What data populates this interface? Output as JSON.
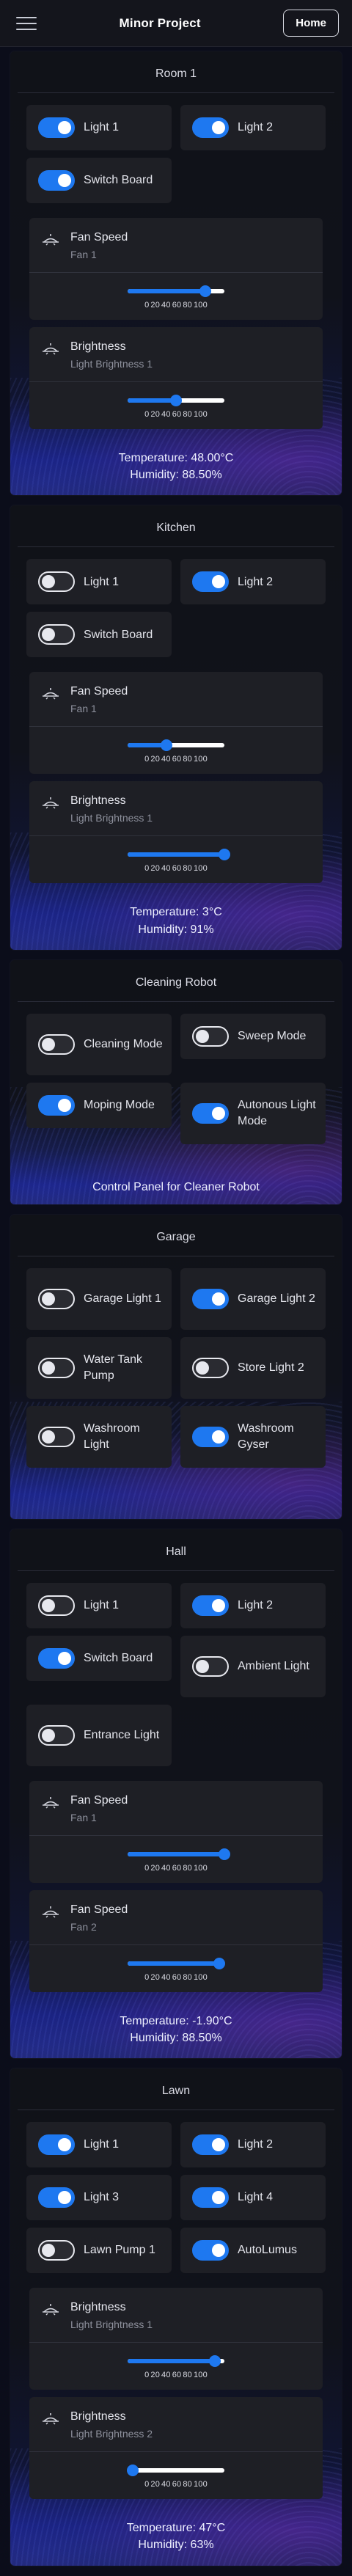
{
  "navbar": {
    "title": "Minor Project",
    "home_label": "Home"
  },
  "tick_labels": [
    "0",
    "20",
    "40",
    "60",
    "80",
    "100"
  ],
  "rooms": [
    {
      "title": "Room 1",
      "switches": [
        {
          "label": "Light 1",
          "on": true
        },
        {
          "label": "Light 2",
          "on": true
        },
        {
          "label": "Switch Board",
          "on": true
        }
      ],
      "controls": [
        {
          "title": "Fan Speed",
          "subtitle": "Fan 1",
          "value": 80
        },
        {
          "title": "Brightness",
          "subtitle": "Light Brightness 1",
          "value": 50
        }
      ],
      "temperature": "Temperature: 48.00°C",
      "humidity": "Humidity: 88.50%"
    },
    {
      "title": "Kitchen",
      "switches": [
        {
          "label": "Light 1",
          "on": false
        },
        {
          "label": "Light 2",
          "on": true
        },
        {
          "label": "Switch Board",
          "on": false
        }
      ],
      "controls": [
        {
          "title": "Fan Speed",
          "subtitle": "Fan 1",
          "value": 40
        },
        {
          "title": "Brightness",
          "subtitle": "Light Brightness 1",
          "value": 100
        }
      ],
      "temperature": "Temperature: 3°C",
      "humidity": "Humidity: 91%"
    },
    {
      "title": "Cleaning Robot",
      "switches": [
        {
          "label": "Cleaning Mode",
          "on": false
        },
        {
          "label": "Sweep Mode",
          "on": false
        },
        {
          "label": "Moping Mode",
          "on": true
        },
        {
          "label": "Autonous Light Mode",
          "on": true
        }
      ],
      "controls": [],
      "note": "Control Panel for Cleaner Robot"
    },
    {
      "title": "Garage",
      "switches": [
        {
          "label": "Garage Light 1",
          "on": false
        },
        {
          "label": "Garage Light 2",
          "on": true
        },
        {
          "label": "Water Tank Pump",
          "on": false
        },
        {
          "label": "Store Light 2",
          "on": false
        },
        {
          "label": "Washroom Light",
          "on": false
        },
        {
          "label": "Washroom Gyser",
          "on": true
        }
      ],
      "controls": []
    },
    {
      "title": "Hall",
      "switches": [
        {
          "label": "Light 1",
          "on": false
        },
        {
          "label": "Light 2",
          "on": true
        },
        {
          "label": "Switch Board",
          "on": true
        },
        {
          "label": "Ambient Light",
          "on": false
        },
        {
          "label": "Entrance Light",
          "on": false
        }
      ],
      "controls": [
        {
          "title": "Fan Speed",
          "subtitle": "Fan 1",
          "value": 100
        },
        {
          "title": "Fan Speed",
          "subtitle": "Fan 2",
          "value": 95
        }
      ],
      "temperature": "Temperature: -1.90°C",
      "humidity": "Humidity: 88.50%"
    },
    {
      "title": "Lawn",
      "switches": [
        {
          "label": "Light 1",
          "on": true
        },
        {
          "label": "Light 2",
          "on": true
        },
        {
          "label": "Light 3",
          "on": true
        },
        {
          "label": "Light 4",
          "on": true
        },
        {
          "label": "Lawn Pump 1",
          "on": false
        },
        {
          "label": "AutoLumus",
          "on": true
        }
      ],
      "controls": [
        {
          "title": "Brightness",
          "subtitle": "Light Brightness 1",
          "value": 90
        },
        {
          "title": "Brightness",
          "subtitle": "Light Brightness 2",
          "value": 5
        }
      ],
      "temperature": "Temperature: 47°C",
      "humidity": "Humidity: 63%"
    }
  ]
}
